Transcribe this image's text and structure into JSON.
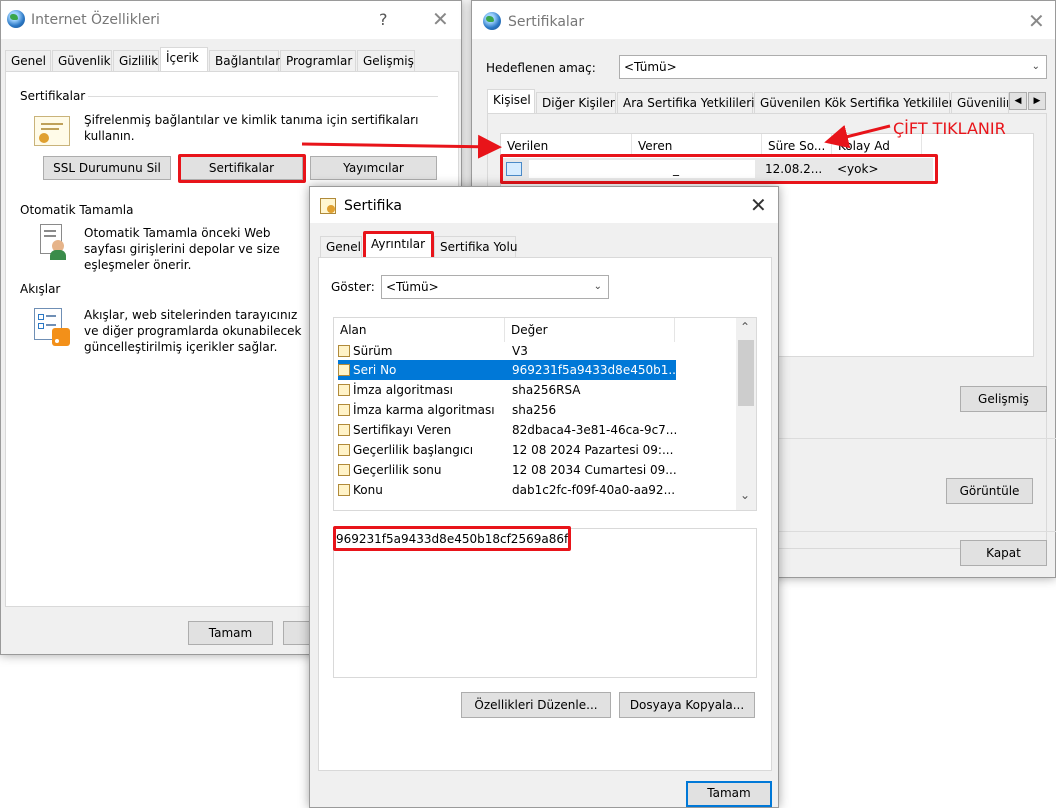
{
  "internet_options": {
    "title": "Internet Özellikleri",
    "help_glyph": "?",
    "close_glyph": "✕",
    "tabs": [
      "Genel",
      "Güvenlik",
      "Gizlilik",
      "İçerik",
      "Bağlantılar",
      "Programlar",
      "Gelişmiş"
    ],
    "selected_tab": "İçerik",
    "certificates_group": {
      "label": "Sertifikalar",
      "description": "Şifrelenmiş bağlantılar ve kimlik tanıma için sertifikaları kullanın.",
      "ssl_button": "SSL Durumunu Sil",
      "certificates_button": "Sertifikalar",
      "publishers_button": "Yayımcılar"
    },
    "autocomplete_group": {
      "label": "Otomatik Tamamla",
      "description": "Otomatik Tamamla önceki Web sayfası girişlerini depolar ve size eşleşmeler önerir."
    },
    "feeds_group": {
      "label": "Akışlar",
      "description": "Akışlar, web sitelerinden tarayıcınız ve diğer programlarda okunabilecek güncelleştirilmiş içerikler sağlar."
    },
    "ok_button": "Tamam"
  },
  "certificates_window": {
    "title": "Sertifikalar",
    "close_glyph": "✕",
    "purpose_label": "Hedeflenen amaç:",
    "purpose_value": "<Tümü>",
    "tabs": [
      "Kişisel",
      "Diğer Kişiler",
      "Ara Sertifika Yetkilileri",
      "Güvenilen Kök Sertifika Yetkilileri",
      "Güvenilir"
    ],
    "selected_tab": "Kişisel",
    "columns": [
      "Verilen",
      "Veren",
      "Süre So...",
      "Kolay Ad"
    ],
    "row": {
      "issued_to": "",
      "issued_by": "_",
      "expires": "12.08.2...",
      "friendly_name": "<yok>"
    },
    "advanced_button": "Gelişmiş",
    "view_button": "Görüntüle",
    "close_button": "Kapat",
    "annotation": "ÇİFT TIKLANIR"
  },
  "certificate_dialog": {
    "title": "Sertifika",
    "close_glyph": "✕",
    "tabs": [
      "Genel",
      "Ayrıntılar",
      "Sertifika Yolu"
    ],
    "selected_tab": "Ayrıntılar",
    "show_label": "Göster:",
    "show_value": "<Tümü>",
    "columns": [
      "Alan",
      "Değer"
    ],
    "fields": [
      {
        "name": "Sürüm",
        "value": "V3"
      },
      {
        "name": "Seri No",
        "value": "969231f5a9433d8e450b1..."
      },
      {
        "name": "İmza algoritması",
        "value": "sha256RSA"
      },
      {
        "name": "İmza karma algoritması",
        "value": "sha256"
      },
      {
        "name": "Sertifikayı Veren",
        "value": "82dbaca4-3e81-46ca-9c7..."
      },
      {
        "name": "Geçerlilik başlangıcı",
        "value": "12 08 2024 Pazartesi 09:..."
      },
      {
        "name": "Geçerlilik sonu",
        "value": "12 08 2034 Cumartesi 09..."
      },
      {
        "name": "Konu",
        "value": "dab1c2fc-f09f-40a0-aa92..."
      }
    ],
    "selected_field": "Seri No",
    "detail_value": "969231f5a9433d8e450b18cf2569a86f",
    "edit_properties_button": "Özellikleri Düzenle...",
    "copy_to_file_button": "Dosyaya Kopyala...",
    "ok_button": "Tamam"
  },
  "colors": {
    "highlight": "#e8141a",
    "selection": "#0078d7",
    "dialog_bg": "#f0f0f0"
  }
}
